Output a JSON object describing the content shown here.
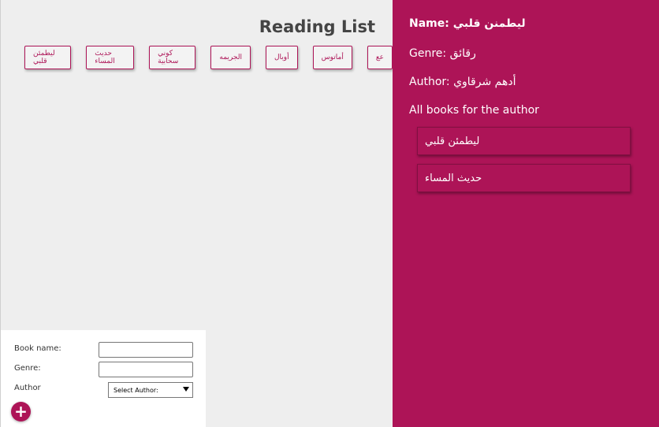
{
  "main": {
    "title": "Reading List",
    "books": [
      "عع",
      "أماتوس",
      "أوبال",
      "الجريمه",
      "كوني سحابية",
      "حديث المساء",
      "ليطمئن قلبي"
    ]
  },
  "form": {
    "book_name_label": "Book name:",
    "genre_label": "Genre:",
    "author_label": "Author",
    "book_name_value": "",
    "genre_value": "",
    "author_select": "Select Author:",
    "add_button": "+"
  },
  "detail": {
    "name": "Name: ليطمنن قلبي",
    "genre": "Genre: رقائق",
    "author": "Author: أدهم شرقاوي",
    "all_books_heading": "All books for the author",
    "author_books": [
      "ليطمئن قلبي",
      "حديث المساء"
    ]
  },
  "colors": {
    "accent": "#ad1457",
    "main_bg": "#eeeeee"
  }
}
